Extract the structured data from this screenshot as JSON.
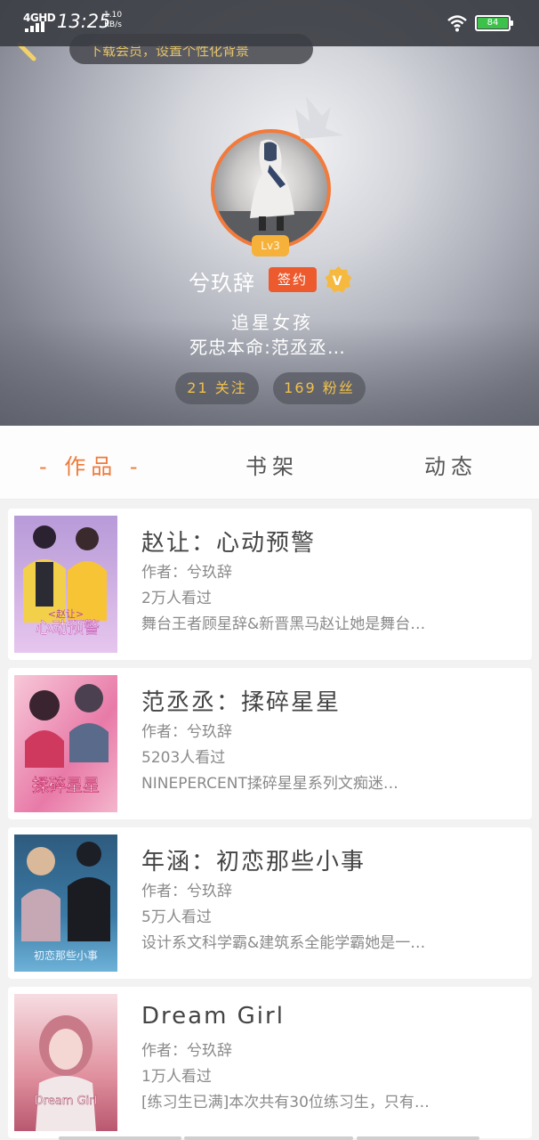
{
  "status_bar": {
    "network": "4GHD",
    "time": "13:25",
    "speed_value": "1.10",
    "speed_unit": "KB/s",
    "battery": "84",
    "battery_color": "#3cc24a"
  },
  "top_banner": "下载会员，设置个性化背景",
  "profile": {
    "level": "Lv3",
    "username": "兮玖辞",
    "sign_badge": "签约",
    "v_badge": "V",
    "bio_line1": "追星女孩",
    "bio_line2": "死忠本命:范丞丞…",
    "following": "21 关注",
    "fans": "169 粉丝"
  },
  "tabs": [
    {
      "label": "- 作品 -",
      "active": true
    },
    {
      "label": "书架",
      "active": false
    },
    {
      "label": "动态",
      "active": false
    }
  ],
  "books": [
    {
      "title": "赵让：心动预警",
      "author": "作者：兮玖辞",
      "views": "2万人看过",
      "desc": "舞台王者顾星辞&新晋黑马赵让她是舞台…",
      "cover_text_top": "<赵让>",
      "cover_text_main": "心动预警"
    },
    {
      "title": "范丞丞：揉碎星星",
      "author": "作者：兮玖辞",
      "views": "5203人看过",
      "desc": "NINEPERCENT揉碎星星系列文痴迷…",
      "cover_text_main": "揉碎星星"
    },
    {
      "title": "年涵：初恋那些小事",
      "author": "作者：兮玖辞",
      "views": "5万人看过",
      "desc": "设计系文科学霸&建筑系全能学霸她是一…",
      "cover_text_main": "初恋那些小事"
    },
    {
      "title": "Dream Girl",
      "author": "作者：兮玖辞",
      "views": "1万人看过",
      "desc": "[练习生已满]本次共有30位练习生，只有…",
      "cover_text_main": "Dream Girl"
    }
  ],
  "colors": {
    "accent_orange": "#ef7a3a",
    "gold": "#f0c04a",
    "sign_red": "#ec5a2e"
  }
}
